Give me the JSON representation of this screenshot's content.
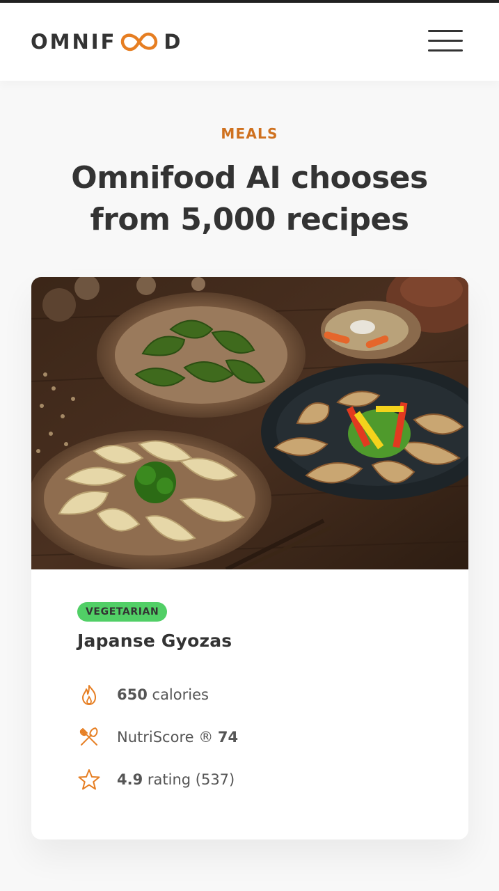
{
  "header": {
    "logo_left": "OMNIF",
    "logo_right": "D",
    "menu_icon": "hamburger-menu-icon"
  },
  "section": {
    "subheading": "MEALS",
    "heading_line1": "Omnifood AI chooses",
    "heading_line2": "from 5,000 recipes"
  },
  "meal": {
    "image_icon": "japanese-gyozas-photo",
    "tag": "VEGETARIAN",
    "title": "Japanse Gyozas",
    "attributes": [
      {
        "icon": "flame-icon",
        "value": "650",
        "text": " calories"
      },
      {
        "icon": "utensils-icon",
        "text": "NutriScore ® ",
        "value": "74"
      },
      {
        "icon": "star-icon",
        "value": "4.9",
        "text": " rating (537)"
      }
    ]
  },
  "colors": {
    "accent": "#e67e22",
    "accent_dark": "#cf711f",
    "tag_green": "#51cf66",
    "text": "#333333"
  }
}
